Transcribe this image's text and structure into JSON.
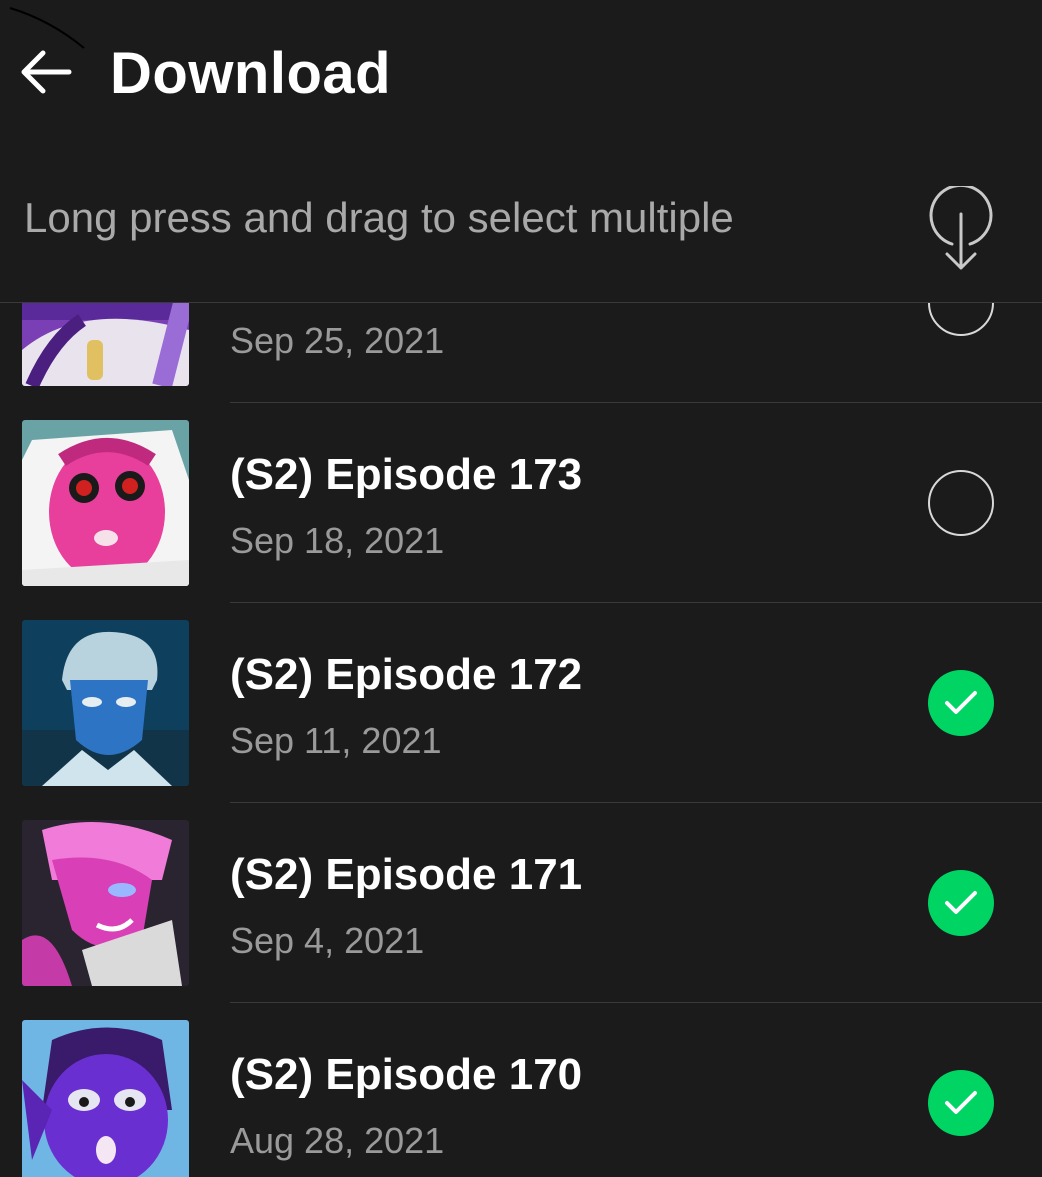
{
  "header": {
    "title": "Download"
  },
  "hint": {
    "text": "Long press and drag to select multiple"
  },
  "accent": "#00d564",
  "episodes": [
    {
      "title": "",
      "date": "Sep 25, 2021",
      "selected": false
    },
    {
      "title": "(S2) Episode 173",
      "date": "Sep 18, 2021",
      "selected": false
    },
    {
      "title": "(S2) Episode 172",
      "date": "Sep 11, 2021",
      "selected": true
    },
    {
      "title": "(S2) Episode 171",
      "date": "Sep 4, 2021",
      "selected": true
    },
    {
      "title": "(S2) Episode 170",
      "date": "Aug 28, 2021",
      "selected": true
    }
  ]
}
